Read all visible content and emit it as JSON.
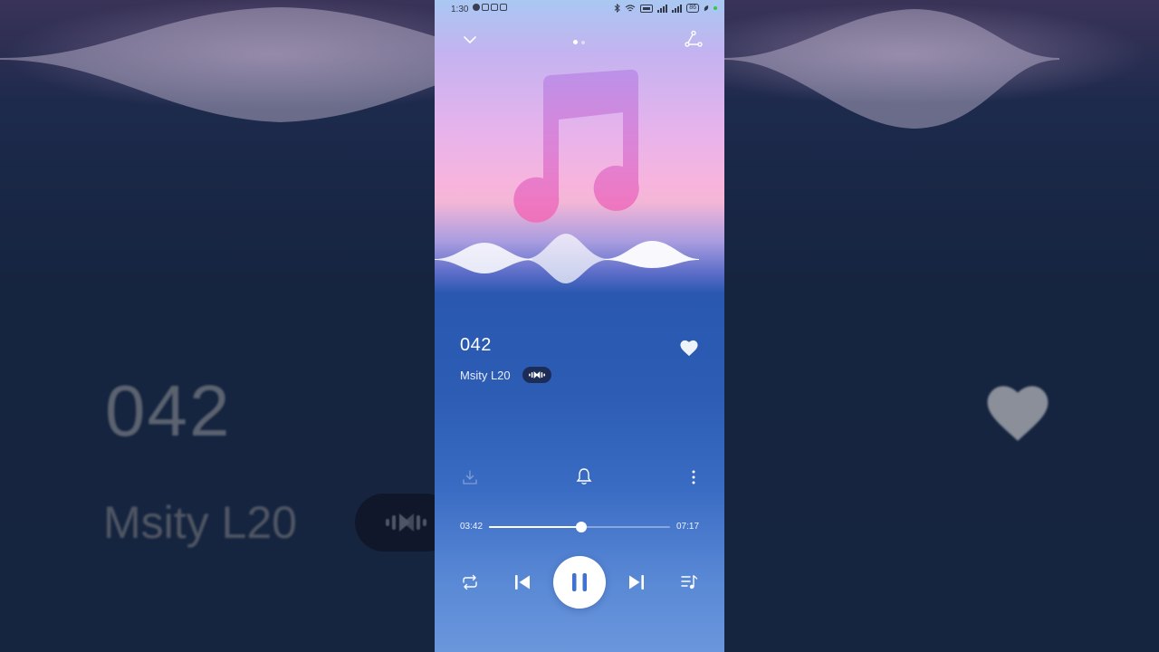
{
  "status_bar": {
    "time": "1:30",
    "battery": "86"
  },
  "header": {
    "collapse_icon": "chevron-down-icon",
    "share_icon": "share-icon",
    "pages": 2,
    "active_page": 1
  },
  "track": {
    "title": "042",
    "artist": "Msity L20",
    "favorite": true
  },
  "actions": {
    "download_icon": "download-icon",
    "ringtone_icon": "bell-icon",
    "more_icon": "more-vertical-icon"
  },
  "progress": {
    "elapsed": "03:42",
    "duration": "07:17",
    "fraction": 0.508
  },
  "controls": {
    "repeat_icon": "repeat-icon",
    "prev_icon": "skip-previous-icon",
    "play_state": "playing",
    "next_icon": "skip-next-icon",
    "playlist_icon": "playlist-icon"
  },
  "colors": {
    "accent": "#ffffff",
    "panel_blue": "#2c5cb4",
    "art_pink": "#f26fb8"
  }
}
